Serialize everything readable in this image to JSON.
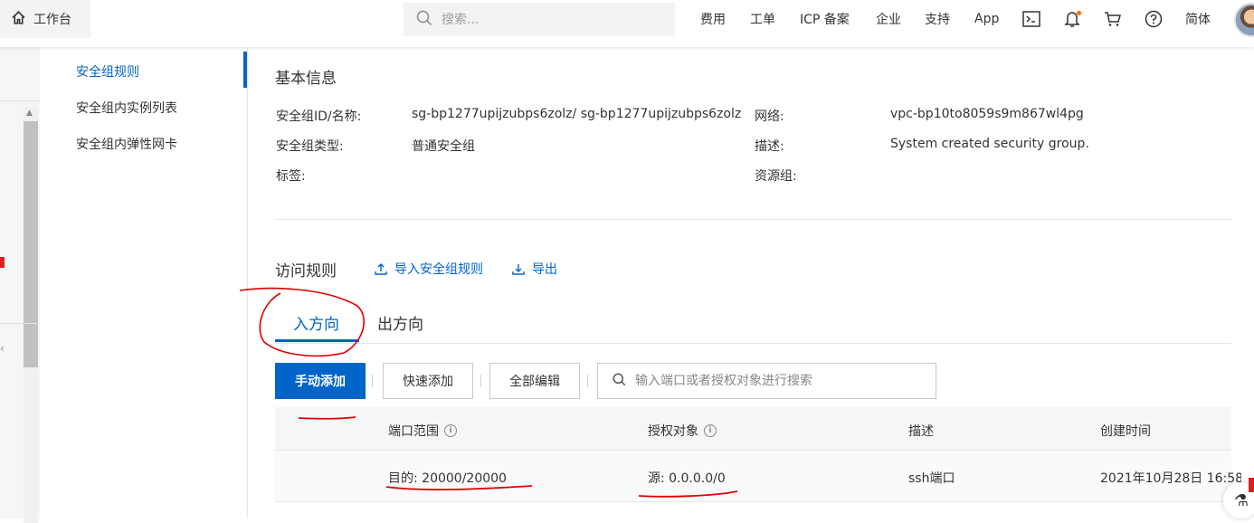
{
  "topbar": {
    "workbench_label": "工作台",
    "search_placeholder": "搜索...",
    "nav": [
      "费用",
      "工单",
      "ICP 备案",
      "企业",
      "支持",
      "App"
    ],
    "language": "简体",
    "icons": [
      "home-icon",
      "search-icon",
      "terminal-icon",
      "bell-icon",
      "cart-icon",
      "help-icon",
      "avatar"
    ],
    "notification_dot_color": "#ff6a00"
  },
  "submenu": {
    "items": [
      "安全组规则",
      "安全组内实例列表",
      "安全组内弹性网卡"
    ],
    "active_index": 0
  },
  "basic_info": {
    "title": "基本信息",
    "fields": [
      {
        "label": "安全组ID/名称:",
        "value": "sg-bp1277upijzubps6zolz/ sg-bp1277upijzubps6zolz"
      },
      {
        "label": "网络:",
        "value": "vpc-bp10to8059s9m867wl4pg"
      },
      {
        "label": "安全组类型:",
        "value": "普通安全组"
      },
      {
        "label": "描述:",
        "value": "System created security group."
      },
      {
        "label": "标签:",
        "value": ""
      },
      {
        "label": "资源组:",
        "value": ""
      }
    ]
  },
  "rules": {
    "title": "访问规则",
    "import_label": "导入安全组规则",
    "export_label": "导出",
    "tabs": [
      "入方向",
      "出方向"
    ],
    "active_tab": 0,
    "buttons": {
      "manual_add": "手动添加",
      "quick_add": "快速添加",
      "edit_all": "全部编辑"
    },
    "search_placeholder": "输入端口或者授权对象进行搜索",
    "columns": [
      "端口范围",
      "授权对象",
      "描述",
      "创建时间"
    ],
    "rows": [
      {
        "port": "目的: 20000/20000",
        "source": "源: 0.0.0.0/0",
        "desc": "ssh端口",
        "created": "2021年10月28日 16:58"
      }
    ]
  },
  "colors": {
    "accent": "#0064c8",
    "annotation": "#e00000"
  }
}
